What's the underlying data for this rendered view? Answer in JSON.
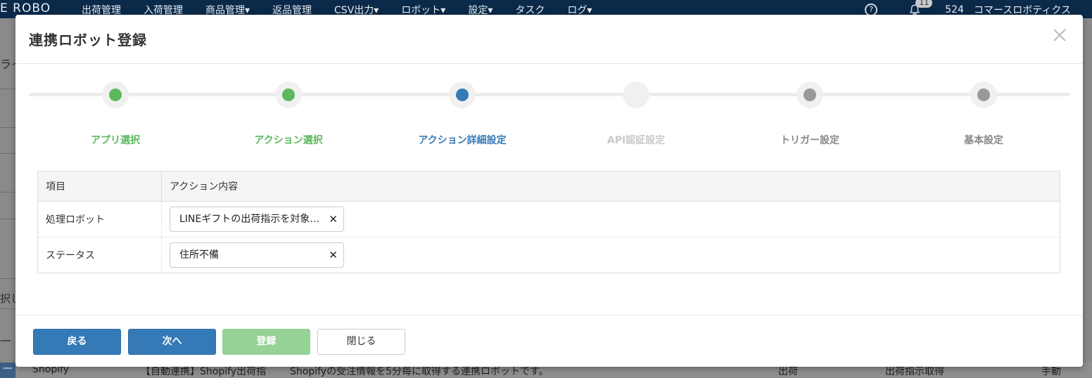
{
  "app": {
    "brand": "E ROBO",
    "menu": [
      "出荷管理",
      "入荷管理",
      "商品管理▾",
      "返品管理",
      "CSV出力▾",
      "ロボット▾",
      "設定▾",
      "タスク",
      "ログ▾"
    ],
    "notification_count": "11",
    "user_id": "524",
    "user_name": "コマースロボティクス"
  },
  "background": {
    "fragments": [
      "ライ",
      "択し",
      "一"
    ],
    "row": {
      "col_app": "Shopify",
      "col_name": "【自動連携】Shopify出荷指",
      "col_desc": "Shopifyの受注情報を5分毎に取得する連携ロボットです。",
      "col_type": "出荷",
      "col_action": "出荷指示取得",
      "col_mode": "手動"
    }
  },
  "modal": {
    "title": "連携ロボット登録",
    "steps": [
      {
        "label": "アプリ選択",
        "state": "done"
      },
      {
        "label": "アクション選択",
        "state": "done"
      },
      {
        "label": "アクション詳細設定",
        "state": "current"
      },
      {
        "label": "API認証設定",
        "state": "skipped"
      },
      {
        "label": "トリガー設定",
        "state": "pending"
      },
      {
        "label": "基本設定",
        "state": "pending"
      }
    ],
    "table": {
      "headers": [
        "項目",
        "アクション内容"
      ],
      "rows": [
        {
          "label": "処理ロボット",
          "value": "LINEギフトの出荷指示を対象ロボット"
        },
        {
          "label": "ステータス",
          "value": "住所不備"
        }
      ]
    },
    "buttons": {
      "back": "戻る",
      "next": "次へ",
      "register": "登録",
      "close": "閉じる"
    }
  },
  "colors": {
    "done": "#5cb85c",
    "current": "#337ab7",
    "pending": "#999999",
    "primary_button": "#337ab7",
    "disabled_button": "#96d196"
  }
}
